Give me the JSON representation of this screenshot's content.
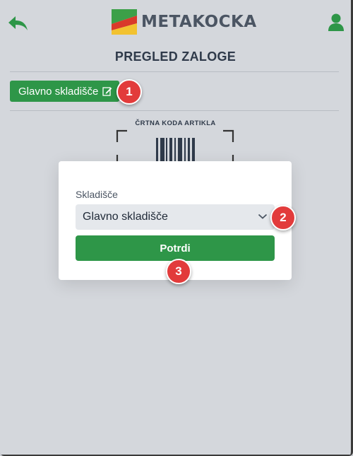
{
  "header": {
    "brand": "METAKOCKA",
    "colors": {
      "brand_green": "#2e9648",
      "logo_red": "#d93a2b",
      "logo_yellow": "#f2c230",
      "logo_green": "#3ca048"
    }
  },
  "page": {
    "title": "PREGLED ZALOGE"
  },
  "warehouse_button": {
    "label": "Glavno skladišče",
    "icon": "edit-icon"
  },
  "scanner": {
    "label": "ČRTNA KODA ARTIKLA",
    "icon": "barcode-icon"
  },
  "modal": {
    "field_label": "Skladišče",
    "select_value": "Glavno skladišče",
    "confirm_label": "Potrdi"
  },
  "badges": [
    "1",
    "2",
    "3"
  ]
}
